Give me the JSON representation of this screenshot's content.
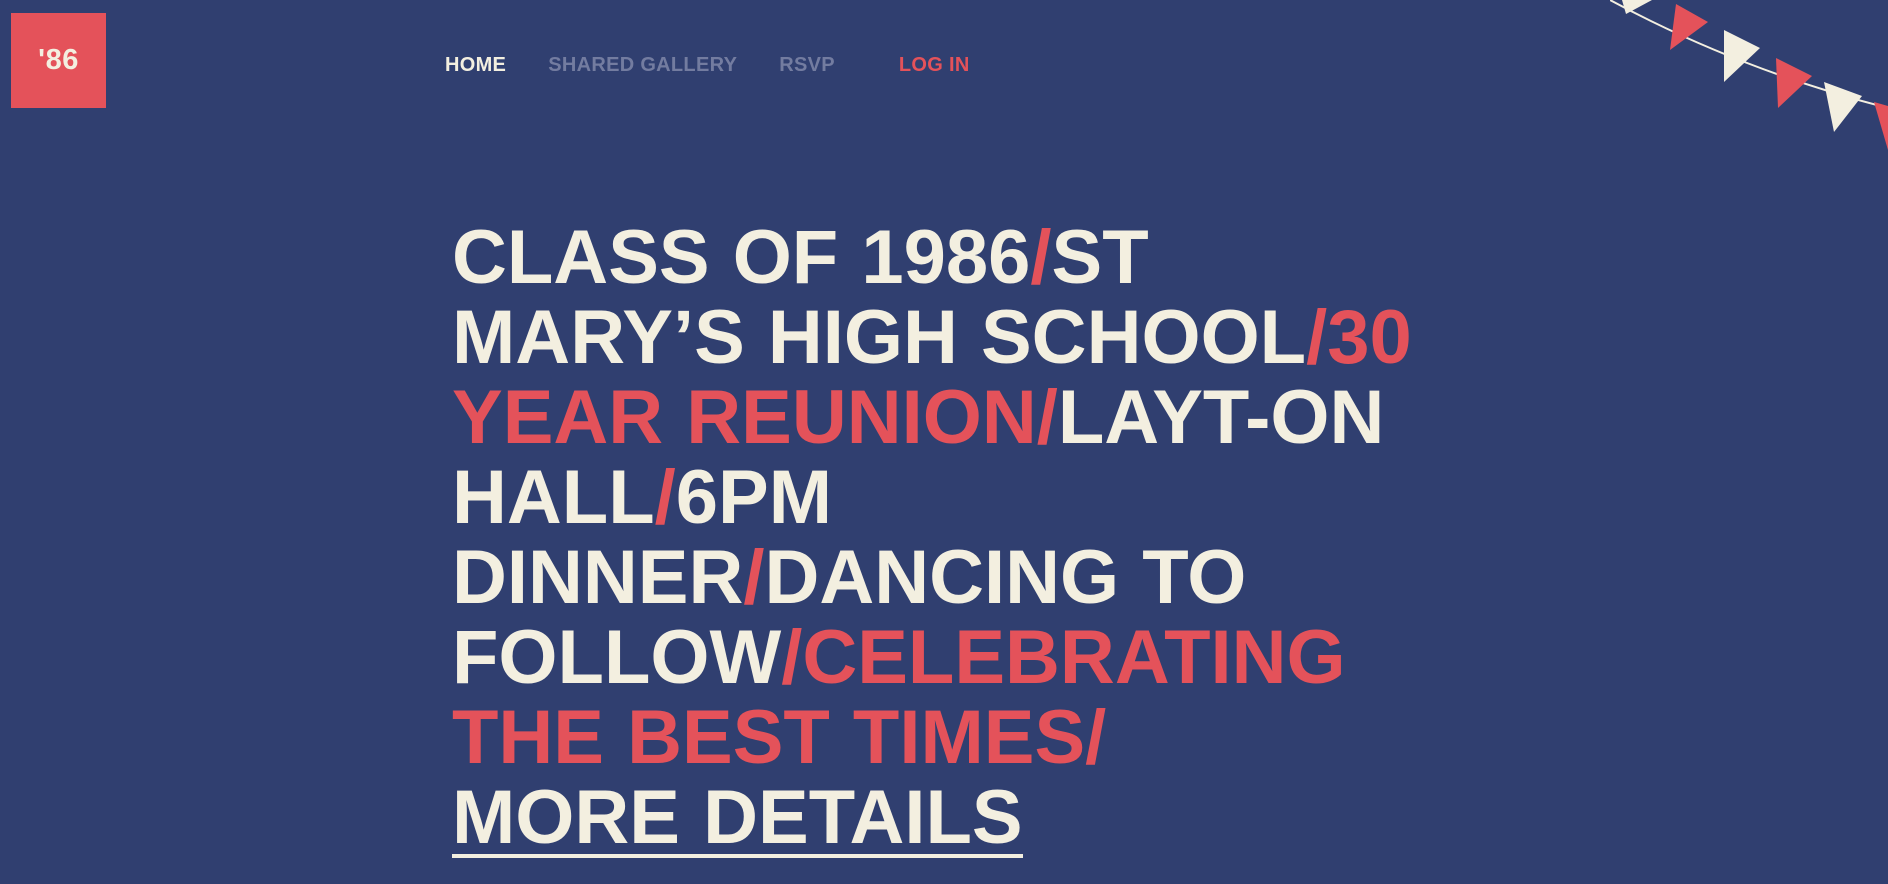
{
  "logo": {
    "text": "'86"
  },
  "nav": {
    "home": "HOME",
    "shared_gallery": "SHARED GALLERY",
    "rsvp": "RSVP",
    "login": "LOG IN"
  },
  "hero": {
    "slash": "/",
    "class_of": "CLASS OF 1986",
    "school": "ST MARY’S HIGH SCHOOL",
    "reunion": "30 YEAR REUNION",
    "venue": "LAYT-ON HALL",
    "dinner": "6PM DINNER",
    "dancing": "DANCING TO FOLLOW",
    "celebrating": "CELEBRATING THE BEST TIMES",
    "more_details": "MORE DETAILS"
  },
  "colors": {
    "background": "#303f70",
    "accent": "#e4525a",
    "cream": "#f3efe0",
    "muted_nav": "#737ca0"
  }
}
